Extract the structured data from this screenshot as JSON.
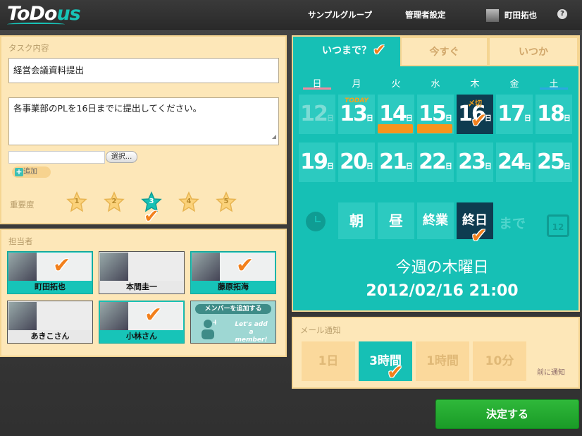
{
  "app": {
    "logo_main": "ToDo",
    "logo_accent": "us"
  },
  "nav": {
    "group": "サンプルグループ",
    "admin": "管理者設定",
    "user": "町田拓也",
    "help": "?"
  },
  "task": {
    "section_label": "タスク内容",
    "title_value": "経営会議資料提出",
    "description_value": "各事業部のPLを16日までに提出してください。",
    "file_value": "",
    "select_button": "選択...",
    "add_button": "追加",
    "importance_label": "重要度",
    "importance_options": [
      "1",
      "2",
      "3",
      "4",
      "5"
    ],
    "importance_selected": 3
  },
  "assignees": {
    "section_label": "担当者",
    "people": [
      {
        "name": "町田拓也",
        "selected": true
      },
      {
        "name": "本間圭一",
        "selected": false
      },
      {
        "name": "藤原拓海",
        "selected": true
      },
      {
        "name": "あきこさん",
        "selected": false
      },
      {
        "name": "小林さん",
        "selected": true
      }
    ],
    "add_member_header": "メンバーを追加する",
    "add_member_en": "Let's add a member!"
  },
  "calendar": {
    "tabs": [
      "いつまで？",
      "今すぐ",
      "いつか"
    ],
    "weekdays": [
      "日",
      "月",
      "火",
      "水",
      "木",
      "金",
      "土"
    ],
    "weeks": [
      [
        "12",
        "13",
        "14",
        "15",
        "16",
        "17",
        "18"
      ],
      [
        "19",
        "20",
        "21",
        "22",
        "23",
        "24",
        "25"
      ]
    ],
    "day_suffix": "日",
    "today_label": "TODAY",
    "deadline_label": "〆切",
    "times": [
      "朝",
      "昼",
      "終業",
      "終日"
    ],
    "selected_time": "終日",
    "until": "まで",
    "calendar_icon_number": "12",
    "result_line1": "今週の木曜日",
    "result_line2": "2012/02/16 21:00"
  },
  "mail": {
    "section_label": "メール通知",
    "options": [
      "1日",
      "3時間",
      "1時間",
      "10分"
    ],
    "selected": "3時間",
    "before_label": "前に通知"
  },
  "submit_label": "決定する",
  "colors": {
    "teal": "#16c0b5",
    "cream": "#fde7b8",
    "orange_check": "#f2801c",
    "green": "#1fa52d",
    "navy": "#0e3c50"
  }
}
